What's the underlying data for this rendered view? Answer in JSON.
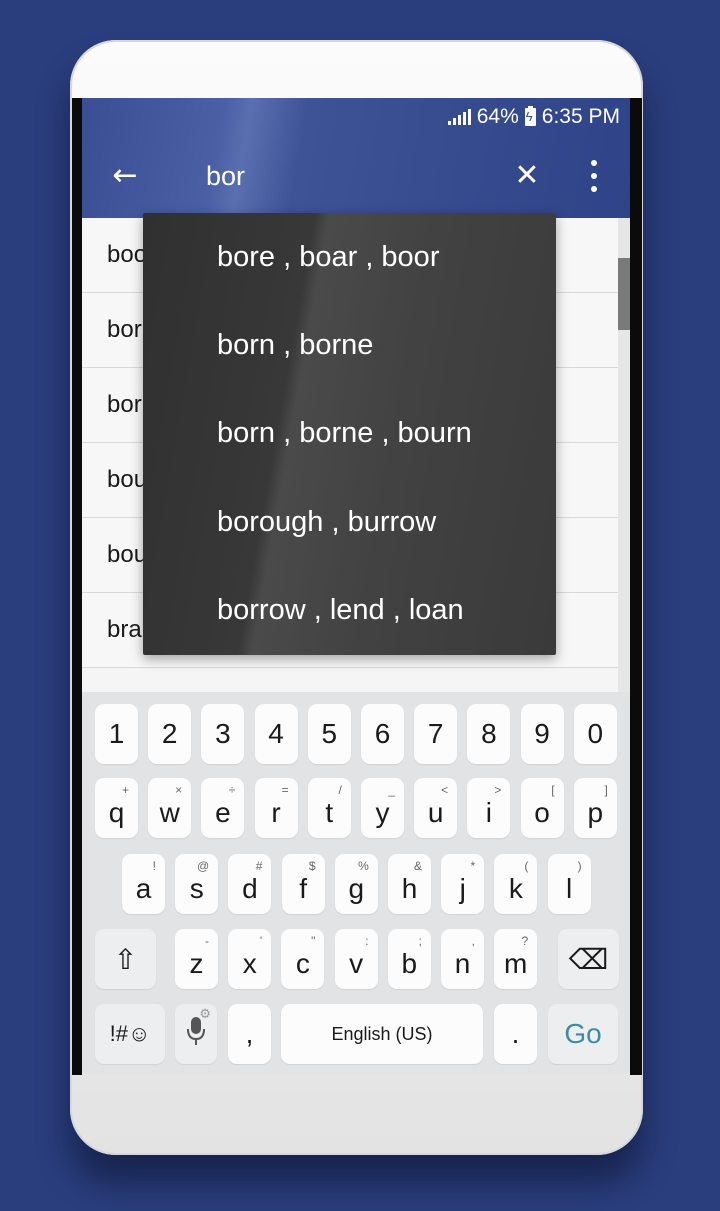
{
  "status_bar": {
    "signal_icon": "cellular-signal-icon",
    "battery_percent": "64%",
    "battery_icon": "battery-charging-icon",
    "time": "6:35 PM"
  },
  "toolbar": {
    "back_icon": "←",
    "search_value": "bor",
    "clear_icon": "✕",
    "more_icon": "more-vert-icon"
  },
  "list": {
    "items": [
      {
        "label": "boo"
      },
      {
        "label": "bor"
      },
      {
        "label": "bor"
      },
      {
        "label": "bou"
      },
      {
        "label": "bou"
      },
      {
        "label": "bra"
      }
    ]
  },
  "suggestions": [
    {
      "label": "bore , boar , boor"
    },
    {
      "label": "born , borne"
    },
    {
      "label": "born , borne , bourn"
    },
    {
      "label": "borough , burrow"
    },
    {
      "label": "borrow , lend , loan"
    }
  ],
  "keyboard": {
    "number_row": [
      "1",
      "2",
      "3",
      "4",
      "5",
      "6",
      "7",
      "8",
      "9",
      "0"
    ],
    "row1": [
      {
        "key": "q",
        "sub": "+"
      },
      {
        "key": "w",
        "sub": "×"
      },
      {
        "key": "e",
        "sub": "÷"
      },
      {
        "key": "r",
        "sub": "="
      },
      {
        "key": "t",
        "sub": "/"
      },
      {
        "key": "y",
        "sub": "_"
      },
      {
        "key": "u",
        "sub": "<"
      },
      {
        "key": "i",
        "sub": ">"
      },
      {
        "key": "o",
        "sub": "["
      },
      {
        "key": "p",
        "sub": "]"
      }
    ],
    "row2": [
      {
        "key": "a",
        "sub": "!"
      },
      {
        "key": "s",
        "sub": "@"
      },
      {
        "key": "d",
        "sub": "#"
      },
      {
        "key": "f",
        "sub": "$"
      },
      {
        "key": "g",
        "sub": "%"
      },
      {
        "key": "h",
        "sub": "&"
      },
      {
        "key": "j",
        "sub": "*"
      },
      {
        "key": "k",
        "sub": "("
      },
      {
        "key": "l",
        "sub": ")"
      }
    ],
    "row3": [
      {
        "key": "z",
        "sub": "-"
      },
      {
        "key": "x",
        "sub": "'"
      },
      {
        "key": "c",
        "sub": "\""
      },
      {
        "key": "v",
        "sub": ":"
      },
      {
        "key": "b",
        "sub": ";"
      },
      {
        "key": "n",
        "sub": ","
      },
      {
        "key": "m",
        "sub": "?"
      }
    ],
    "shift_icon": "⇧",
    "backspace_icon": "⌫",
    "symbols_label": "!#☺",
    "mic_icon": "🎙",
    "mic_gear_icon": "⚙",
    "comma": ",",
    "space_label": "English (US)",
    "period": ".",
    "go_label": "Go"
  }
}
